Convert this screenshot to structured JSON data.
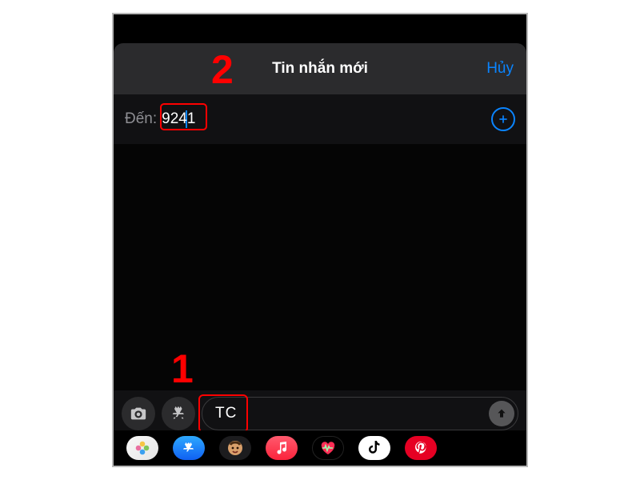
{
  "header": {
    "title": "Tin nhắn mới",
    "cancel": "Hủy"
  },
  "recipient": {
    "label": "Đến:",
    "value": "9241"
  },
  "message": {
    "text": "TC"
  },
  "annotations": {
    "step1": "1",
    "step2": "2"
  },
  "apps": {
    "photos": "photos-app",
    "appstore": "app-store",
    "memoji": "memoji",
    "music": "apple-music",
    "fitness": "fitness",
    "tiktok": "tiktok",
    "pinterest": "pinterest"
  }
}
